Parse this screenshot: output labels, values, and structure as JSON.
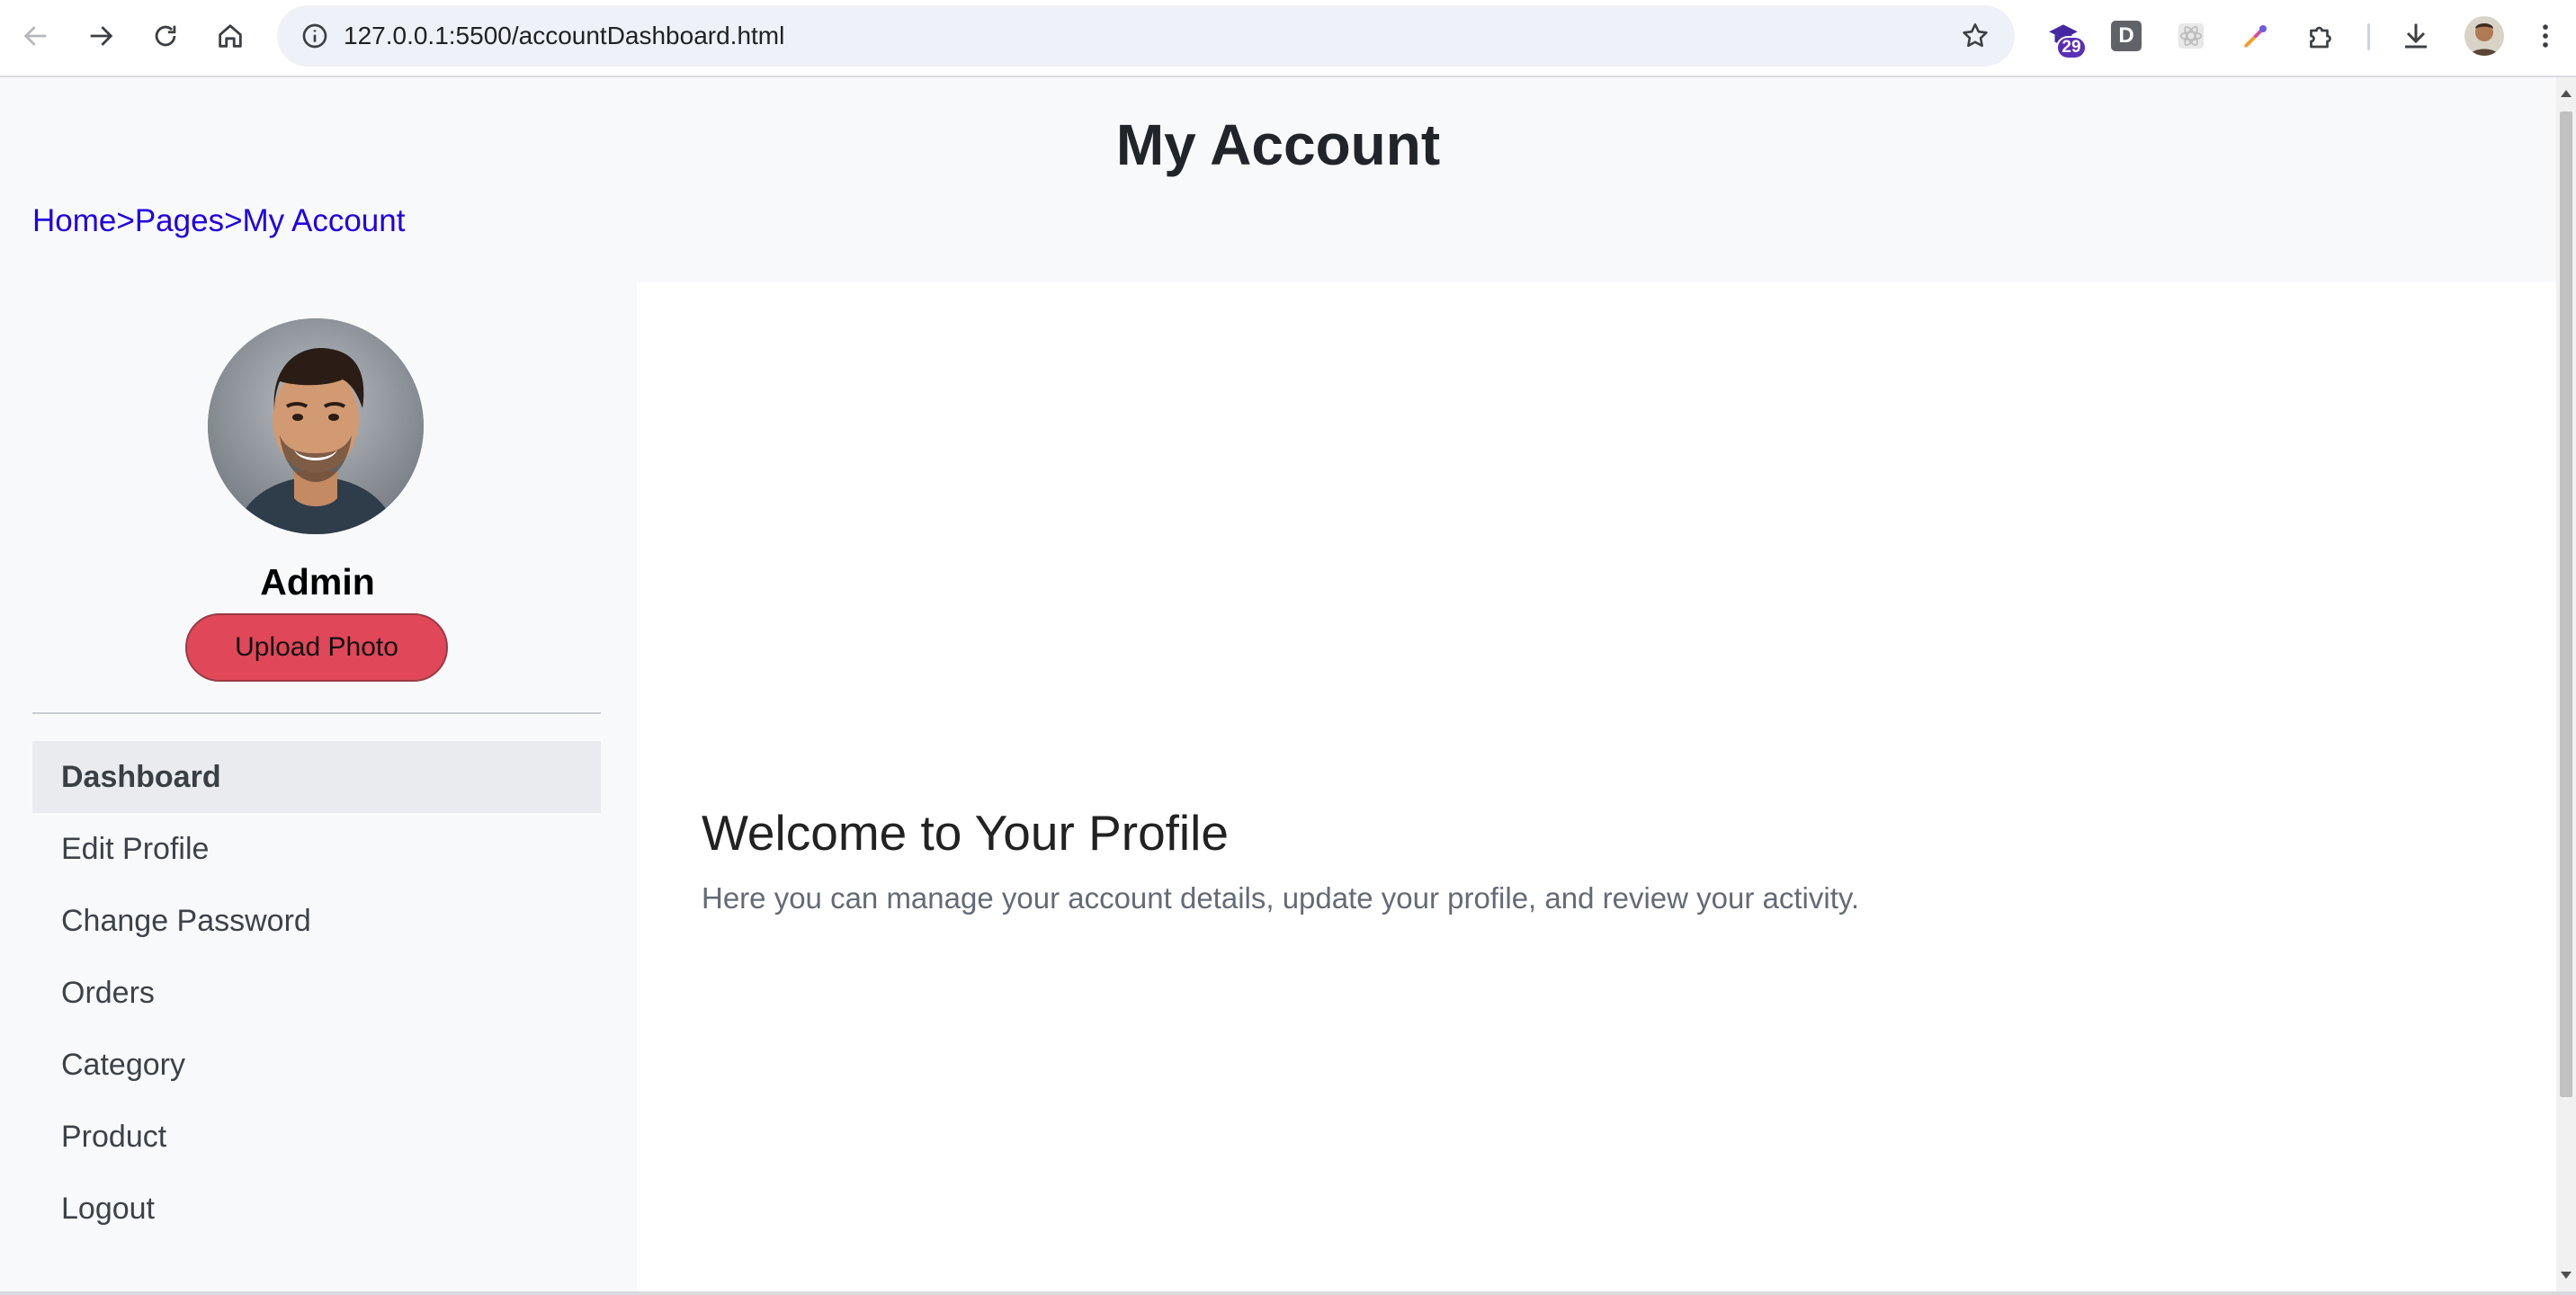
{
  "browser": {
    "url": "127.0.0.1:5500/accountDashboard.html",
    "extension_badge": "29",
    "extension_d_label": "D",
    "icons": [
      "back-icon",
      "forward-icon",
      "reload-icon",
      "home-icon",
      "info-icon",
      "star-icon",
      "graduation-cap-icon",
      "atom-icon",
      "eyedropper-icon",
      "puzzle-icon",
      "download-icon",
      "kebab-menu-icon"
    ]
  },
  "page": {
    "title": "My Account"
  },
  "breadcrumb": {
    "items": [
      "Home",
      "Pages",
      "My Account"
    ],
    "separator": ">"
  },
  "sidebar": {
    "user_name": "Admin",
    "upload_label": "Upload Photo",
    "menu": [
      {
        "label": "Dashboard",
        "active": true
      },
      {
        "label": "Edit Profile",
        "active": false
      },
      {
        "label": "Change Password",
        "active": false
      },
      {
        "label": "Orders",
        "active": false
      },
      {
        "label": "Category",
        "active": false
      },
      {
        "label": "Product",
        "active": false
      },
      {
        "label": "Logout",
        "active": false
      }
    ]
  },
  "main": {
    "heading": "Welcome to Your Profile",
    "description": "Here you can manage your account details, update your profile, and review your activity."
  },
  "colors": {
    "breadcrumb_link": "#2000e0",
    "upload_button": "#e04758",
    "active_menu_bg": "#e9ebee",
    "page_bg": "#f8f9fb",
    "content_bg": "#ffffff"
  }
}
